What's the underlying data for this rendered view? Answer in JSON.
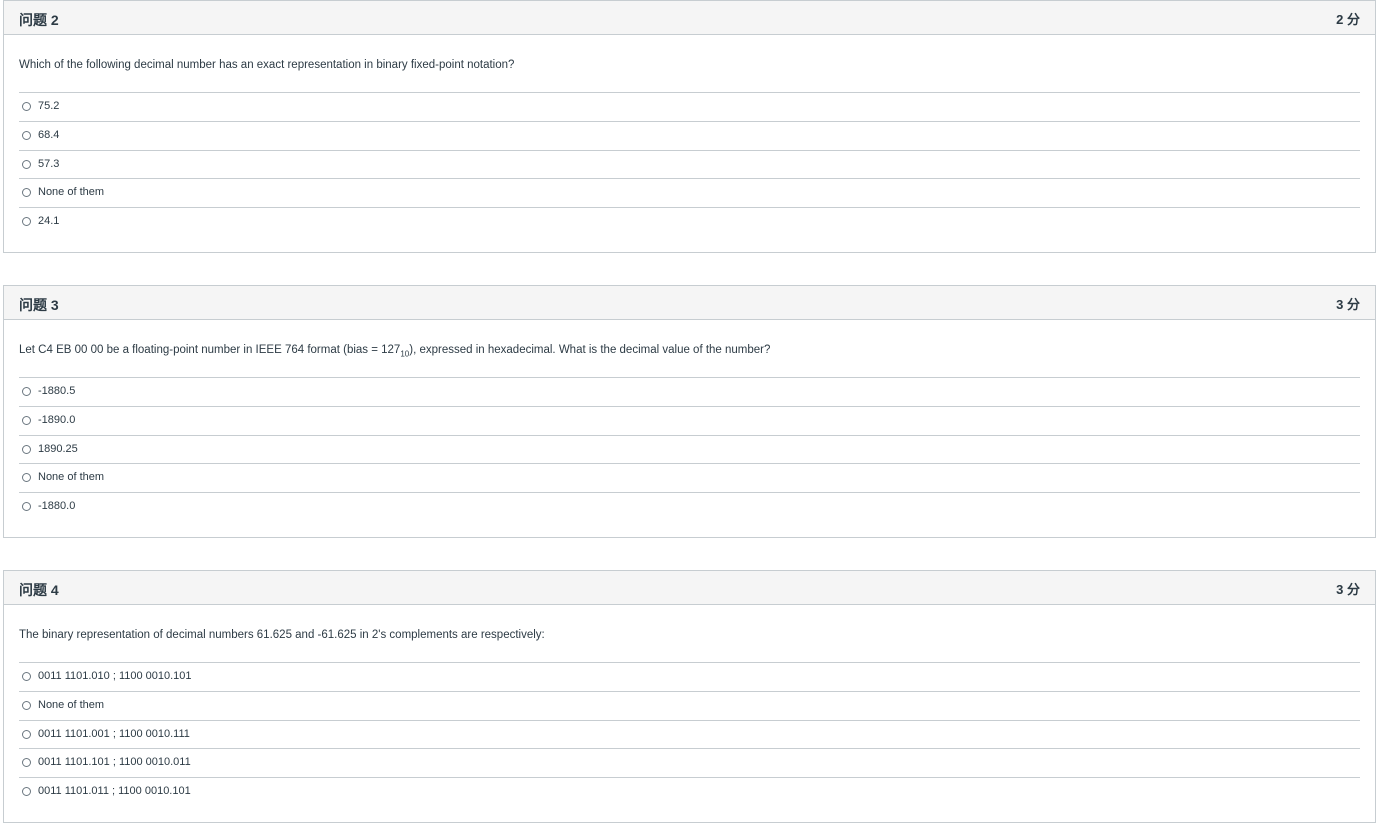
{
  "questions": [
    {
      "title": "问题 2",
      "points": "2 分",
      "text": "Which of the following decimal number has an exact representation in binary fixed-point notation?",
      "answers": [
        "75.2",
        "68.4",
        "57.3",
        "None of them",
        "24.1"
      ]
    },
    {
      "title": "问题 3",
      "points": "3 分",
      "text_before": "Let C4 EB 00 00 be a floating-point number in IEEE 764 format (bias = 127",
      "text_sub": "10",
      "text_after": "), expressed in hexadecimal. What is the decimal value of the number?",
      "answers": [
        "-1880.5",
        "-1890.0",
        "1890.25",
        "None of them",
        "-1880.0"
      ]
    },
    {
      "title": "问题 4",
      "points": "3 分",
      "text": "The binary representation of decimal numbers 61.625 and -61.625 in 2's complements are respectively:",
      "answers": [
        "0011 1101.010 ; 1100 0010.101",
        "None of them",
        "0011 1101.001 ; 1100 0010.111",
        "0011 1101.101 ; 1100 0010.011",
        "0011 1101.011 ; 1100 0010.101"
      ]
    }
  ]
}
